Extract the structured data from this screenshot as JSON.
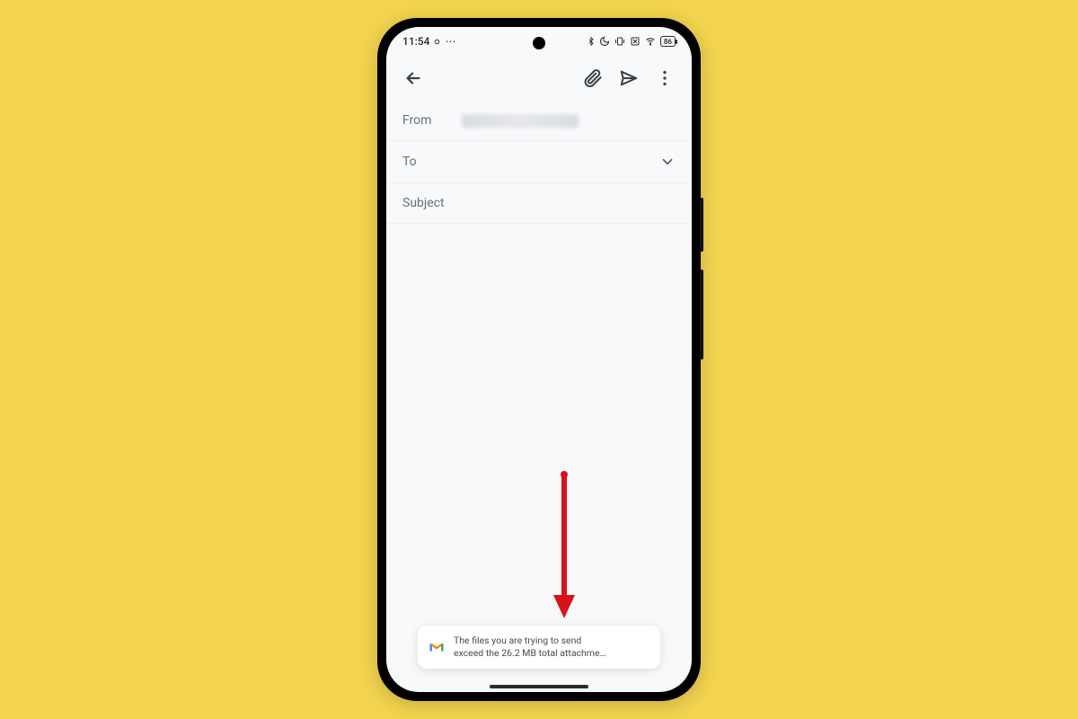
{
  "status": {
    "time": "11:54",
    "battery": "86"
  },
  "compose": {
    "from_label": "From",
    "to_label": "To",
    "subject_label": "Subject"
  },
  "toast": {
    "line1": "The files you are trying to send",
    "line2": "exceed the 26.2 MB total attachme…"
  }
}
